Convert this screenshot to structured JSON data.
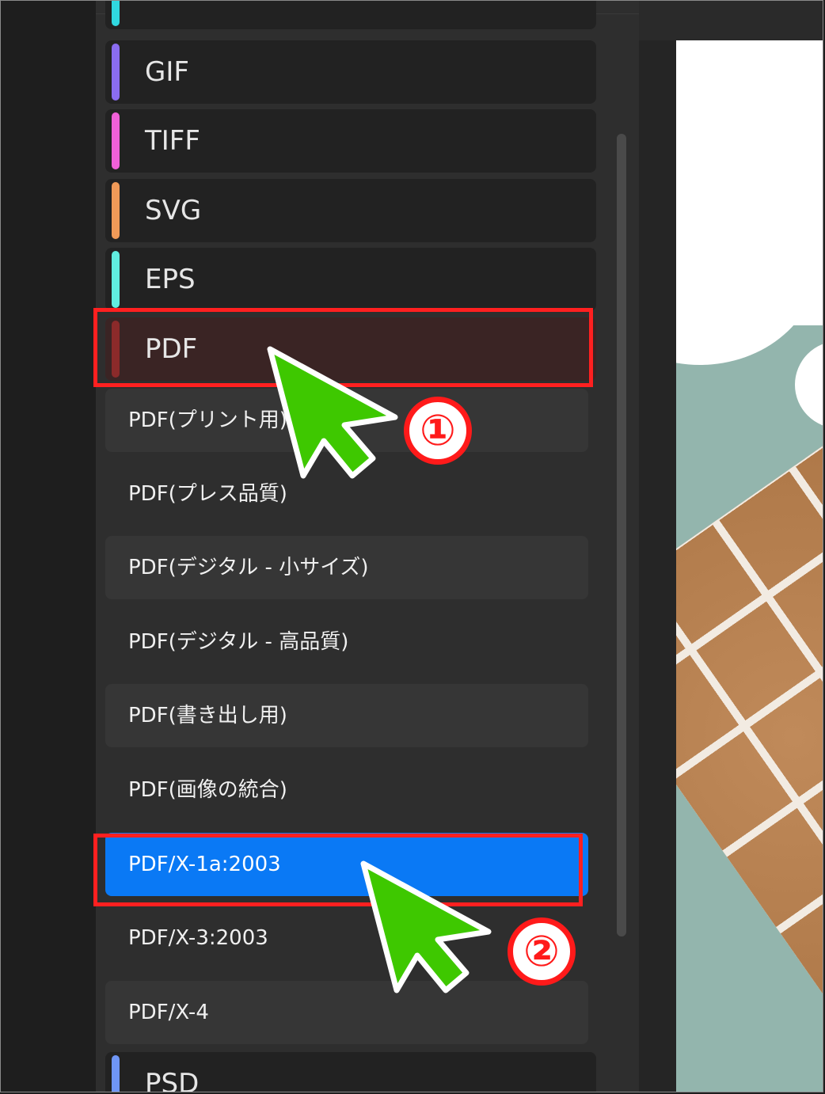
{
  "categories": [
    {
      "label": "GIF",
      "color": "#8a6cf0"
    },
    {
      "label": "TIFF",
      "color": "#f060d8"
    },
    {
      "label": "SVG",
      "color": "#f09a58"
    },
    {
      "label": "EPS",
      "color": "#60eee0"
    },
    {
      "label": "PDF",
      "color": "#8b2a2a"
    },
    {
      "label": "PSD",
      "color": "#6f96f6"
    }
  ],
  "top_partial_color": "#30d8e0",
  "pdf_presets": [
    "PDF(プリント用)",
    "PDF(プレス品質)",
    "PDF(デジタル - 小サイズ)",
    "PDF(デジタル - 高品質)",
    "PDF(書き出し用)",
    "PDF(画像の統合)",
    "PDF/X-1a:2003",
    "PDF/X-3:2003",
    "PDF/X-4"
  ],
  "selected_preset": "PDF/X-1a:2003",
  "annotations": {
    "step1": "①",
    "step2": "②",
    "highlight_color": "#ff2020",
    "cursor_color": "#3ec800"
  }
}
